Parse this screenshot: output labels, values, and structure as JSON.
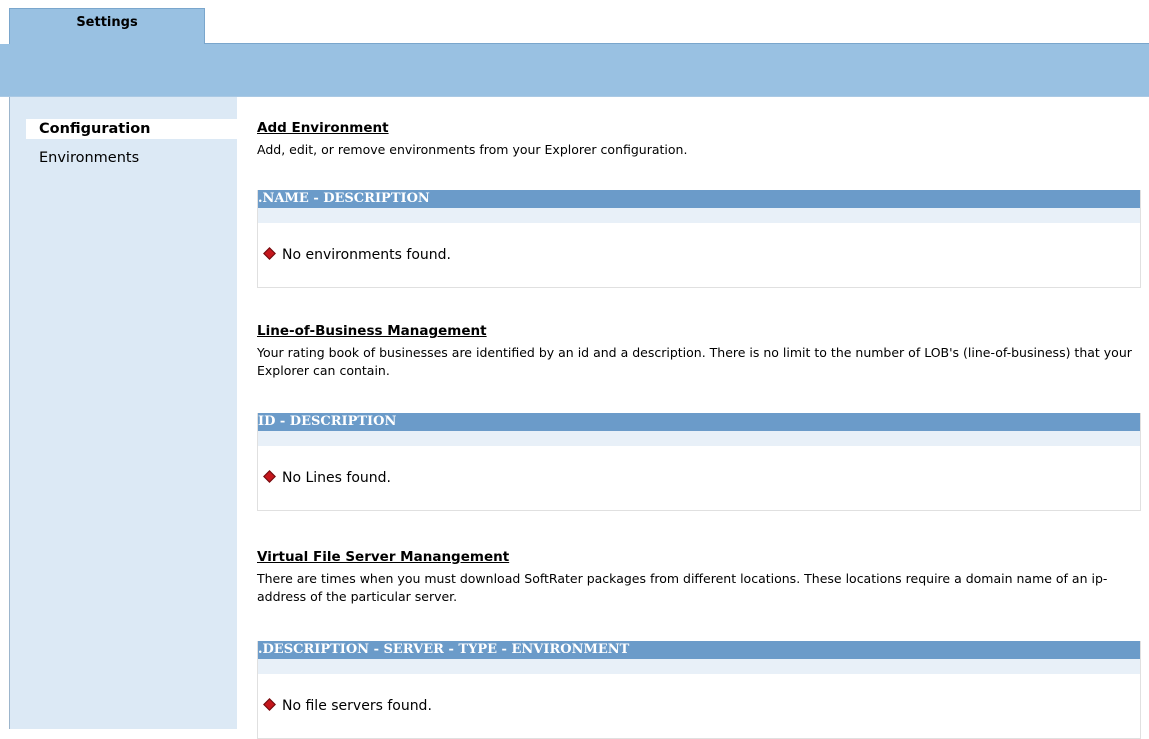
{
  "tabs": [
    {
      "label": "Settings",
      "active": true
    }
  ],
  "sidebar": {
    "items": [
      {
        "label": "Configuration",
        "active": true
      },
      {
        "label": "Environments",
        "active": false
      }
    ]
  },
  "sections": [
    {
      "title": "Add Environment",
      "description": "Add, edit, or remove environments from your Explorer configuration.",
      "grid_header": ".NAME - DESCRIPTION",
      "empty_message": "No environments found."
    },
    {
      "title": "Line-of-Business Management",
      "description": "Your rating book of businesses are identified by an id and a description. There is no limit to the number of LOB's (line-of-business) that your Explorer can contain.",
      "grid_header": "ID - DESCRIPTION",
      "empty_message": "No Lines found."
    },
    {
      "title": "Virtual File Server Manangement",
      "description": "There are times when you must download SoftRater packages from different locations. These locations require a domain name of an ip-address of the particular server.",
      "grid_header": ".DESCRIPTION - SERVER - TYPE - ENVIRONMENT",
      "empty_message": "No file servers found."
    }
  ],
  "icons": {
    "empty_indicator": "red-diamond-icon"
  },
  "colors": {
    "banner": "#99c1e2",
    "grid_header": "#6b9bc9",
    "sidebar": "#dce9f5",
    "indicator": "#c4161c"
  }
}
